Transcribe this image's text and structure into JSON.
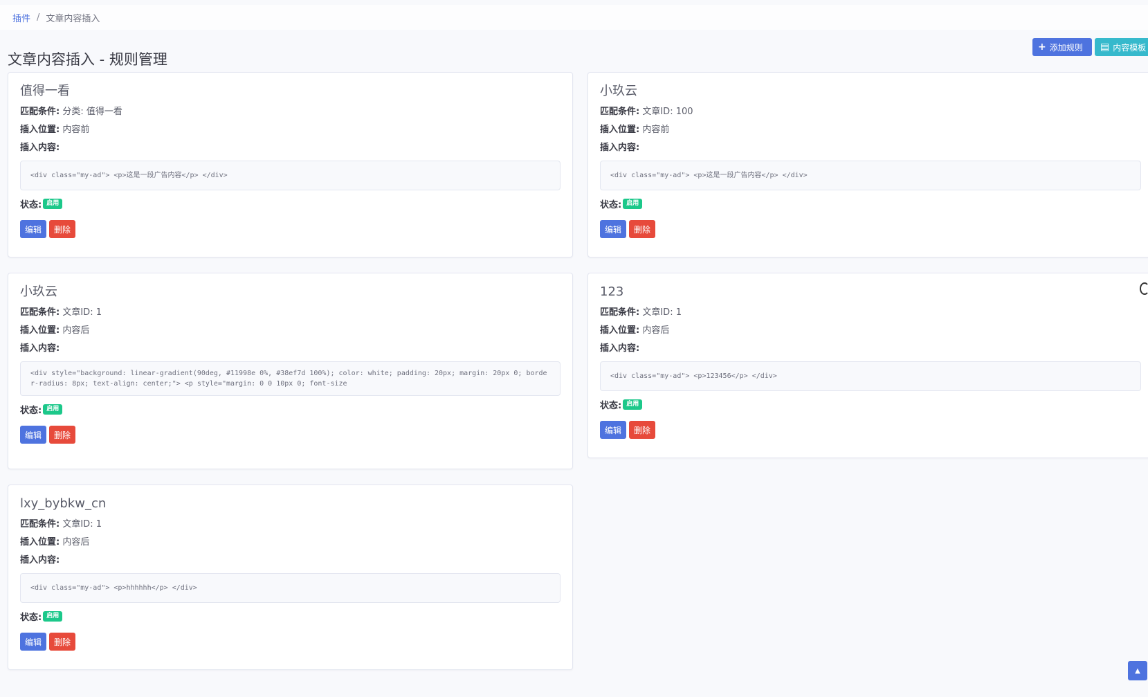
{
  "breadcrumb": {
    "root": "插件",
    "separator": "/",
    "current": "文章内容插入"
  },
  "page": {
    "title": "文章内容插入 - 规则管理"
  },
  "toolbar": {
    "add_label": "添加规则",
    "add_icon": "plus-icon",
    "template_label": "内容模板",
    "template_icon": "clipboard-icon"
  },
  "labels": {
    "match": "匹配条件:",
    "position": "插入位置:",
    "content": "插入内容:",
    "status": "状态:",
    "edit": "编辑",
    "delete": "删除"
  },
  "rules": [
    {
      "title": "值得一看",
      "match": "分类: 值得一看",
      "position": "内容前",
      "content": "<div class=\"my-ad\"> <p>这是一段广告内容</p> </div>",
      "status": "启用"
    },
    {
      "title": "小玖云",
      "match": "文章ID: 100",
      "position": "内容前",
      "content": "<div class=\"my-ad\"> <p>这是一段广告内容</p> </div>",
      "status": "启用"
    },
    {
      "title": "小玖云",
      "match": "文章ID: 1",
      "position": "内容后",
      "content": "<div style=\"background: linear-gradient(90deg, #11998e 0%, #38ef7d 100%); color: white; padding: 20px; margin: 20px 0; border-radius: 8px; text-align: center;\"> <p style=\"margin: 0 0 10px 0; font-size",
      "status": "启用"
    },
    {
      "title": "123",
      "match": "文章ID: 1",
      "position": "内容后",
      "content": "<div class=\"my-ad\"> <p>123456</p> </div>",
      "status": "启用"
    },
    {
      "title": "lxy_bybkw_cn",
      "match": "文章ID: 1",
      "position": "内容后",
      "content": "<div class=\"my-ad\"> <p>hhhhhh</p> </div>",
      "status": "启用"
    }
  ],
  "colors": {
    "primary": "#4e73df",
    "info": "#36b9cc",
    "success": "#1cc88a",
    "danger": "#e74a3b",
    "background": "#f8f9fc"
  }
}
